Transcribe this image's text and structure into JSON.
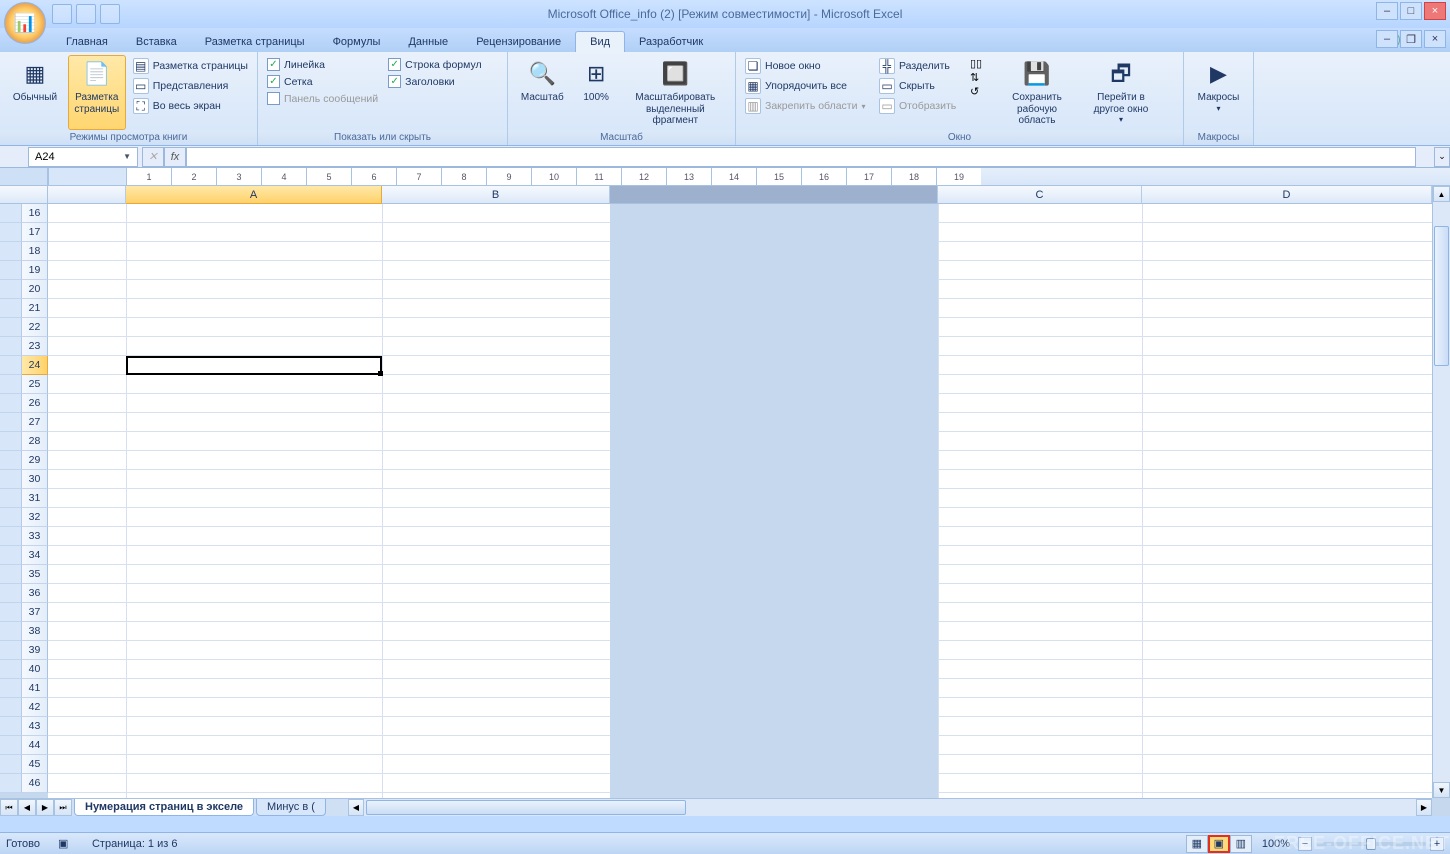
{
  "title": "Microsoft Office_info (2) [Режим совместимости] - Microsoft Excel",
  "tabs": {
    "t0": "Главная",
    "t1": "Вставка",
    "t2": "Разметка страницы",
    "t3": "Формулы",
    "t4": "Данные",
    "t5": "Рецензирование",
    "t6": "Вид",
    "t7": "Разработчик"
  },
  "ribbon": {
    "views": {
      "normal": "Обычный",
      "layout": "Разметка страницы",
      "layout_small": "Разметка страницы",
      "previews": "Представления",
      "fullscreen": "Во весь экран",
      "group": "Режимы просмотра книги"
    },
    "show": {
      "ruler": "Линейка",
      "grid": "Сетка",
      "msgpanel": "Панель сообщений",
      "formulabar": "Строка формул",
      "headings": "Заголовки",
      "group": "Показать или скрыть"
    },
    "zoom": {
      "zoom": "Масштаб",
      "z100": "100%",
      "zoomsel": "Масштабировать выделенный фрагмент",
      "group": "Масштаб"
    },
    "window": {
      "newwin": "Новое окно",
      "arrange": "Упорядочить все",
      "freeze": "Закрепить области",
      "split": "Разделить",
      "hide": "Скрыть",
      "unhide": "Отобразить",
      "save_ws": "Сохранить рабочую область",
      "switch": "Перейти в другое окно",
      "group": "Окно"
    },
    "macros": {
      "macros": "Макросы",
      "group": "Макросы"
    }
  },
  "namebox": "A24",
  "columns": {
    "A": "A",
    "B": "B",
    "C": "C",
    "D": "D"
  },
  "rows": {
    "r16": "16",
    "r17": "17",
    "r18": "18",
    "r19": "19",
    "r20": "20",
    "r21": "21",
    "r22": "22",
    "r23": "23",
    "r24": "24",
    "r25": "25",
    "r26": "26",
    "r27": "27",
    "r28": "28",
    "r29": "29",
    "r30": "30",
    "r31": "31",
    "r32": "32",
    "r33": "33",
    "r34": "34",
    "r35": "35",
    "r36": "36",
    "r37": "37",
    "r38": "38",
    "r39": "39",
    "r40": "40",
    "r41": "41",
    "r42": "42",
    "r43": "43",
    "r44": "44",
    "r45": "45",
    "r46": "46"
  },
  "ruler_ticks": {
    "t1": "1",
    "t2": "2",
    "t3": "3",
    "t4": "4",
    "t5": "5",
    "t6": "6",
    "t7": "7",
    "t8": "8",
    "t9": "9",
    "t10": "10",
    "t11": "11",
    "t12": "12",
    "t13": "13",
    "t14": "14",
    "t15": "15",
    "t16": "16",
    "t17": "17",
    "t18": "18",
    "t19": "19"
  },
  "sheets": {
    "s1": "Нумерация страниц в экселе",
    "s2": "Минус в ("
  },
  "status": {
    "ready": "Готово",
    "page": "Страница: 1 из 6",
    "zoom": "100%"
  },
  "watermark": "FREE-OFFICE.NET"
}
